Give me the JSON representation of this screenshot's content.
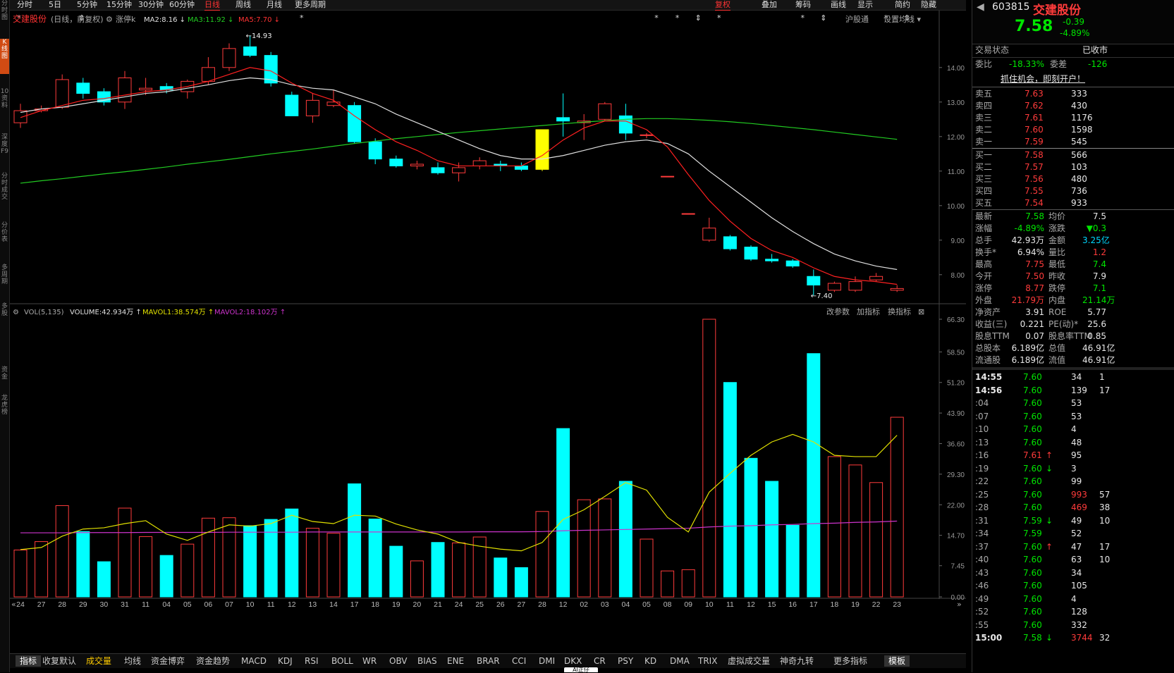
{
  "top_tabs": [
    "分时",
    "5日",
    "5分钟",
    "15分钟",
    "30分钟",
    "60分钟",
    "日线",
    "周线",
    "月线",
    "更多周期"
  ],
  "top_right": [
    "复权",
    "叠加",
    "筹码",
    "画线",
    "显示",
    "简约",
    "隐藏"
  ],
  "left_tabs": [
    "分时图",
    "K线图",
    "10资料",
    "深度F9",
    "分时成交",
    "分价表",
    "多周期",
    "多股",
    "资金",
    "龙虎榜"
  ],
  "kpanel": {
    "name": "交建股份",
    "mode": "(日线，前复权)",
    "limit": "涨停k",
    "ma2": "MA2:8.16",
    "ma3": "MA3:11.92",
    "ma5": "MA5:7.70",
    "links": [
      "沪股通",
      "设置均线"
    ],
    "ann_high": "14.93",
    "ann_low": "7.40"
  },
  "vpanel": {
    "name": "VOL(5,135)",
    "volume": "VOLUME:42.934万",
    "mavol1": "MAVOL1:38.574万",
    "mavol2": "MAVOL2:18.102万",
    "links": [
      "改参数",
      "加指标",
      "换指标"
    ]
  },
  "bottom_tabs": [
    "指标",
    "收复默认",
    "成交量",
    "均线",
    "资金博弈",
    "资金趋势",
    "MACD",
    "KDJ",
    "RSI",
    "BOLL",
    "WR",
    "OBV",
    "BIAS",
    "ENE",
    "BRAR",
    "CCI",
    "DMI",
    "DKX",
    "CR",
    "PSY",
    "KD",
    "DMA",
    "TRIX",
    "虚拟成交量",
    "神奇九转",
    "更多指标",
    "模板"
  ],
  "bottom_bubble": "AI正仔",
  "colors": {
    "up": "#ff3b3b",
    "down": "#00ffff",
    "ma_a": "#ff2020",
    "ma_b": "#e0e0e0",
    "ma_c": "#22cc22",
    "mavol1": "#e0e000",
    "mavol2": "#cc33cc",
    "bg": "#000000"
  },
  "chart_data": {
    "type": "candlestick",
    "price_axis": {
      "ticks": [
        8.0,
        9.0,
        10.0,
        11.0,
        12.0,
        13.0,
        14.0
      ],
      "range": [
        7.2,
        15.2
      ]
    },
    "volume_axis": {
      "ticks": [
        0.0,
        7.45,
        14.7,
        22.0,
        29.3,
        36.6,
        43.9,
        51.2,
        58.5,
        66.3
      ],
      "range": [
        0,
        66.3
      ]
    },
    "x_labels": [
      "24",
      "27",
      "28",
      "29",
      "30",
      "31",
      "11",
      "04",
      "05",
      "06",
      "07",
      "10",
      "11",
      "12",
      "13",
      "14",
      "17",
      "18",
      "19",
      "20",
      "21",
      "24",
      "25",
      "26",
      "27",
      "28",
      "12",
      "02",
      "03",
      "04",
      "05",
      "08",
      "09",
      "10",
      "11",
      "12",
      "15",
      "16",
      "17",
      "18",
      "19",
      "22",
      "23"
    ],
    "candles": [
      {
        "o": 12.4,
        "h": 12.95,
        "l": 12.25,
        "c": 12.75,
        "v": 11.2
      },
      {
        "o": 12.75,
        "h": 12.9,
        "l": 12.7,
        "c": 12.8,
        "v": 13.2
      },
      {
        "o": 12.85,
        "h": 13.8,
        "l": 12.8,
        "c": 13.65,
        "v": 21.8
      },
      {
        "o": 13.55,
        "h": 13.7,
        "l": 13.1,
        "c": 13.25,
        "v": 15.6
      },
      {
        "o": 13.3,
        "h": 13.4,
        "l": 12.9,
        "c": 13.0,
        "v": 8.4
      },
      {
        "o": 13.0,
        "h": 13.9,
        "l": 12.8,
        "c": 13.7,
        "v": 21.2
      },
      {
        "o": 13.35,
        "h": 13.7,
        "l": 13.2,
        "c": 13.4,
        "v": 14.4
      },
      {
        "o": 13.45,
        "h": 13.55,
        "l": 13.25,
        "c": 13.35,
        "v": 9.9
      },
      {
        "o": 13.3,
        "h": 13.65,
        "l": 13.1,
        "c": 13.6,
        "v": 12.6
      },
      {
        "o": 13.6,
        "h": 14.3,
        "l": 13.5,
        "c": 14.0,
        "v": 18.8
      },
      {
        "o": 14.0,
        "h": 14.7,
        "l": 13.9,
        "c": 14.55,
        "v": 18.9
      },
      {
        "o": 14.6,
        "h": 14.93,
        "l": 14.3,
        "c": 14.35,
        "v": 17.0
      },
      {
        "o": 14.35,
        "h": 14.45,
        "l": 13.45,
        "c": 13.55,
        "v": 18.5
      },
      {
        "o": 13.2,
        "h": 13.3,
        "l": 12.6,
        "c": 12.6,
        "v": 21.0
      },
      {
        "o": 12.6,
        "h": 13.25,
        "l": 12.4,
        "c": 13.05,
        "v": 16.4
      },
      {
        "o": 12.9,
        "h": 13.35,
        "l": 12.85,
        "c": 13.0,
        "v": 15.2
      },
      {
        "o": 12.9,
        "h": 13.0,
        "l": 11.8,
        "c": 11.85,
        "v": 27.0
      },
      {
        "o": 11.85,
        "h": 11.95,
        "l": 11.2,
        "c": 11.35,
        "v": 18.6
      },
      {
        "o": 11.35,
        "h": 11.45,
        "l": 11.1,
        "c": 11.15,
        "v": 12.1
      },
      {
        "o": 11.15,
        "h": 11.3,
        "l": 11.05,
        "c": 11.2,
        "v": 8.6
      },
      {
        "o": 11.1,
        "h": 11.25,
        "l": 10.9,
        "c": 10.95,
        "v": 13.0
      },
      {
        "o": 10.95,
        "h": 11.25,
        "l": 10.7,
        "c": 11.1,
        "v": 12.9
      },
      {
        "o": 11.15,
        "h": 11.4,
        "l": 11.05,
        "c": 11.3,
        "v": 14.3
      },
      {
        "o": 11.2,
        "h": 11.3,
        "l": 11.0,
        "c": 11.15,
        "v": 9.3
      },
      {
        "o": 11.15,
        "h": 11.25,
        "l": 11.0,
        "c": 11.05,
        "v": 7.0
      },
      {
        "o": 11.05,
        "h": 12.2,
        "l": 11.0,
        "c": 12.2,
        "v": 20.4,
        "limit": true
      },
      {
        "o": 12.55,
        "h": 13.25,
        "l": 12.0,
        "c": 12.45,
        "v": 40.2
      },
      {
        "o": 12.4,
        "h": 12.65,
        "l": 11.9,
        "c": 12.45,
        "v": 23.2
      },
      {
        "o": 12.5,
        "h": 13.0,
        "l": 12.45,
        "c": 12.95,
        "v": 23.4
      },
      {
        "o": 12.6,
        "h": 12.95,
        "l": 11.9,
        "c": 12.1,
        "v": 27.6
      },
      {
        "o": 12.05,
        "h": 12.1,
        "l": 11.95,
        "c": 12.05,
        "v": 13.8
      },
      {
        "o": 10.85,
        "h": 10.85,
        "l": 10.85,
        "c": 10.85,
        "v": 6.2
      },
      {
        "o": 9.77,
        "h": 9.77,
        "l": 9.77,
        "c": 9.77,
        "v": 6.5
      },
      {
        "o": 9.0,
        "h": 9.65,
        "l": 8.95,
        "c": 9.35,
        "v": 66.3
      },
      {
        "o": 9.1,
        "h": 9.15,
        "l": 8.7,
        "c": 8.75,
        "v": 51.2
      },
      {
        "o": 8.8,
        "h": 8.85,
        "l": 8.4,
        "c": 8.45,
        "v": 33.1
      },
      {
        "o": 8.45,
        "h": 8.6,
        "l": 8.35,
        "c": 8.4,
        "v": 27.6
      },
      {
        "o": 8.4,
        "h": 8.45,
        "l": 8.2,
        "c": 8.25,
        "v": 17.1
      },
      {
        "o": 7.95,
        "h": 8.15,
        "l": 7.4,
        "c": 7.7,
        "v": 58.1
      },
      {
        "o": 7.55,
        "h": 7.8,
        "l": 7.5,
        "c": 7.75,
        "v": 33.5
      },
      {
        "o": 7.55,
        "h": 7.95,
        "l": 7.5,
        "c": 7.8,
        "v": 31.5
      },
      {
        "o": 7.85,
        "h": 8.05,
        "l": 7.8,
        "c": 7.95,
        "v": 27.3
      },
      {
        "o": 7.55,
        "h": 7.7,
        "l": 7.5,
        "c": 7.6,
        "v": 42.9
      }
    ],
    "ma_short": [
      12.55,
      12.75,
      12.9,
      13.05,
      13.1,
      13.2,
      13.3,
      13.35,
      13.45,
      13.6,
      13.8,
      14.0,
      13.9,
      13.55,
      13.25,
      13.05,
      12.6,
      12.2,
      11.85,
      11.6,
      11.3,
      11.15,
      11.15,
      11.15,
      11.15,
      11.45,
      11.9,
      12.25,
      12.45,
      12.45,
      12.2,
      11.7,
      10.9,
      10.15,
      9.55,
      9.05,
      8.7,
      8.5,
      8.2,
      7.95,
      7.85,
      7.8,
      7.72
    ],
    "ma_mid": [
      12.7,
      12.8,
      12.85,
      12.95,
      13.05,
      13.15,
      13.25,
      13.3,
      13.4,
      13.5,
      13.62,
      13.7,
      13.65,
      13.5,
      13.4,
      13.35,
      13.15,
      12.95,
      12.65,
      12.4,
      12.15,
      11.9,
      11.65,
      11.45,
      11.35,
      11.35,
      11.45,
      11.6,
      11.75,
      11.85,
      11.9,
      11.8,
      11.5,
      11.0,
      10.55,
      10.1,
      9.65,
      9.25,
      8.9,
      8.6,
      8.4,
      8.25,
      8.15
    ],
    "ma_long": [
      10.65,
      10.72,
      10.78,
      10.85,
      10.92,
      10.98,
      11.05,
      11.12,
      11.2,
      11.27,
      11.34,
      11.42,
      11.5,
      11.57,
      11.64,
      11.72,
      11.8,
      11.87,
      11.94,
      12.0,
      12.06,
      12.12,
      12.17,
      12.22,
      12.27,
      12.32,
      12.37,
      12.42,
      12.46,
      12.5,
      12.52,
      12.52,
      12.5,
      12.47,
      12.43,
      12.38,
      12.32,
      12.26,
      12.2,
      12.13,
      12.06,
      11.99,
      11.92
    ],
    "mavol1": [
      11.3,
      11.8,
      14.5,
      16.2,
      16.5,
      17.5,
      18.2,
      15.0,
      13.5,
      15.5,
      17.2,
      16.9,
      17.5,
      19.5,
      18.0,
      17.5,
      19.5,
      19.3,
      17.4,
      16.0,
      15.0,
      13.0,
      12.1,
      11.4,
      11.0,
      13.0,
      18.5,
      20.8,
      24.0,
      27.3,
      25.5,
      19.0,
      15.5,
      25.0,
      29.5,
      33.8,
      37.0,
      38.8,
      37.0,
      33.8,
      33.5,
      33.5,
      38.6
    ],
    "mavol2": [
      15.3,
      15.3,
      15.3,
      15.35,
      15.35,
      15.35,
      15.4,
      15.4,
      15.4,
      15.4,
      15.45,
      15.45,
      15.45,
      15.45,
      15.5,
      15.5,
      15.5,
      15.5,
      15.5,
      15.5,
      15.5,
      15.5,
      15.55,
      15.55,
      15.55,
      15.6,
      15.8,
      15.9,
      16.0,
      16.1,
      16.2,
      16.3,
      16.4,
      16.7,
      16.9,
      17.0,
      17.2,
      17.3,
      17.5,
      17.6,
      17.8,
      17.9,
      18.1
    ]
  },
  "quote": {
    "code": "603815",
    "name": "交建股份",
    "price": "7.58",
    "chg": "-0.39",
    "pct": "-4.89%",
    "status_label": "交易状态",
    "status_value": "已收市",
    "wb_label": "委比",
    "wb_value": "-18.33%",
    "wc_label": "委差",
    "wc_value": "-126",
    "promo": "抓住机会，即刻开户！",
    "asks": [
      [
        "卖五",
        "7.63",
        "333"
      ],
      [
        "卖四",
        "7.62",
        "430"
      ],
      [
        "卖三",
        "7.61",
        "1176"
      ],
      [
        "卖二",
        "7.60",
        "1598"
      ],
      [
        "卖一",
        "7.59",
        "545"
      ]
    ],
    "bids": [
      [
        "买一",
        "7.58",
        "566"
      ],
      [
        "买二",
        "7.57",
        "103"
      ],
      [
        "买三",
        "7.56",
        "480"
      ],
      [
        "买四",
        "7.55",
        "736"
      ],
      [
        "买五",
        "7.54",
        "933"
      ]
    ],
    "stats": [
      [
        "最新",
        "7.58",
        "均价",
        "7.5"
      ],
      [
        "涨幅",
        "-4.89%",
        "涨跌",
        "▼0.3"
      ],
      [
        "总手",
        "42.93万",
        "金额",
        "3.25亿"
      ],
      [
        "换手*",
        "6.94%",
        "量比",
        "1.2"
      ],
      [
        "最高",
        "7.75",
        "最低",
        "7.4"
      ],
      [
        "今开",
        "7.50",
        "昨收",
        "7.9"
      ],
      [
        "涨停",
        "8.77",
        "跌停",
        "7.1"
      ],
      [
        "外盘",
        "21.79万",
        "内盘",
        "21.14万"
      ],
      [
        "净资产",
        "3.91",
        "ROE",
        "5.77"
      ],
      [
        "收益(三)",
        "0.221",
        "PE(动)*",
        "25.6"
      ],
      [
        "股息TTM",
        "0.07",
        "股息率TTM",
        "0.85"
      ],
      [
        "总股本",
        "6.189亿",
        "总值",
        "46.91亿"
      ],
      [
        "流通股",
        "6.189亿",
        "流值",
        "46.91亿"
      ]
    ],
    "ticks": [
      [
        "14:55",
        "7.60",
        "34",
        "",
        "1"
      ],
      [
        "14:56",
        "7.60",
        "139",
        "",
        "17"
      ],
      [
        ":04",
        "7.60",
        "53",
        "",
        ""
      ],
      [
        ":07",
        "7.60",
        "53",
        "",
        ""
      ],
      [
        ":10",
        "7.60",
        "4",
        "",
        ""
      ],
      [
        ":13",
        "7.60",
        "48",
        "",
        ""
      ],
      [
        ":16",
        "7.61",
        "95",
        "up",
        ""
      ],
      [
        ":19",
        "7.60",
        "3",
        "dn",
        ""
      ],
      [
        ":22",
        "7.60",
        "99",
        "",
        ""
      ],
      [
        ":25",
        "7.60",
        "993",
        "",
        "57"
      ],
      [
        ":28",
        "7.60",
        "469",
        "",
        "38"
      ],
      [
        ":31",
        "7.59",
        "49",
        "dn",
        "10"
      ],
      [
        ":34",
        "7.59",
        "52",
        "",
        ""
      ],
      [
        ":37",
        "7.60",
        "47",
        "up",
        "17"
      ],
      [
        ":40",
        "7.60",
        "63",
        "",
        "10"
      ],
      [
        ":43",
        "7.60",
        "34",
        "",
        ""
      ],
      [
        ":46",
        "7.60",
        "105",
        "",
        ""
      ],
      [
        ":49",
        "7.60",
        "4",
        "",
        ""
      ],
      [
        ":52",
        "7.60",
        "128",
        "",
        ""
      ],
      [
        ":55",
        "7.60",
        "332",
        "",
        ""
      ],
      [
        "15:00",
        "7.58",
        "3744",
        "dn",
        "32"
      ]
    ]
  }
}
